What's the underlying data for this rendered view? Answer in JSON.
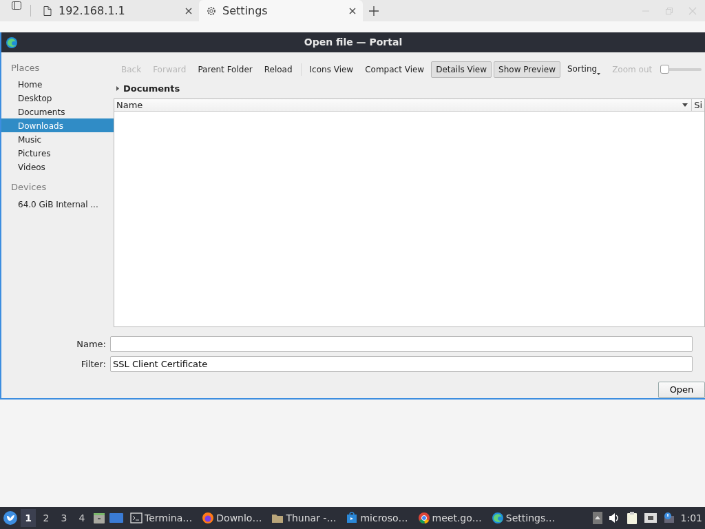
{
  "browser_tabs": [
    {
      "label": "192.168.1.1",
      "kind": "page",
      "selected": false
    },
    {
      "label": "Settings",
      "kind": "settings",
      "selected": true
    }
  ],
  "dialog": {
    "title": "Open file — Portal"
  },
  "sidebar": [
    {
      "heading": "Places",
      "items": [
        {
          "label": "Home",
          "selected": false
        },
        {
          "label": "Desktop",
          "selected": false
        },
        {
          "label": "Documents",
          "selected": false
        },
        {
          "label": "Downloads",
          "selected": true
        },
        {
          "label": "Music",
          "selected": false
        },
        {
          "label": "Pictures",
          "selected": false
        },
        {
          "label": "Videos",
          "selected": false
        }
      ]
    },
    {
      "heading": "Devices",
      "items": [
        {
          "label": "64.0 GiB Internal ...",
          "selected": false
        }
      ]
    }
  ],
  "toolbar": [
    {
      "label": "Back",
      "kind": "button",
      "disabled": true,
      "pressed": false
    },
    {
      "label": "Forward",
      "kind": "button",
      "disabled": true,
      "pressed": false
    },
    {
      "label": "Parent Folder",
      "kind": "button",
      "disabled": false,
      "pressed": false
    },
    {
      "label": "Reload",
      "kind": "button",
      "disabled": false,
      "pressed": false
    },
    {
      "kind": "separator"
    },
    {
      "label": "Icons View",
      "kind": "button",
      "disabled": false,
      "pressed": false
    },
    {
      "label": "Compact View",
      "kind": "button",
      "disabled": false,
      "pressed": false
    },
    {
      "label": "Details View",
      "kind": "button",
      "disabled": false,
      "pressed": true
    },
    {
      "label": "Show Preview",
      "kind": "button",
      "disabled": false,
      "pressed": true
    },
    {
      "label": "Sorting",
      "kind": "menu",
      "disabled": false,
      "pressed": false
    },
    {
      "label": "Zoom out",
      "kind": "button",
      "disabled": true,
      "pressed": false
    },
    {
      "kind": "slider",
      "level": 0
    }
  ],
  "location": "Documents",
  "columns": [
    "Name",
    "Si"
  ],
  "name_field": {
    "label": "Name:"
  },
  "filter_field": {
    "label": "Filter:",
    "value": "SSL Client Certificate"
  },
  "open_button": "Open",
  "taskbar": {
    "workspaces": [
      {
        "label": "1",
        "selected": true
      },
      {
        "label": "2",
        "selected": false
      },
      {
        "label": "3",
        "selected": false
      },
      {
        "label": "4",
        "selected": false
      }
    ],
    "tasks": [
      {
        "label": "Termina…",
        "kind": "terminal"
      },
      {
        "label": "Downlo…",
        "kind": "firefox"
      },
      {
        "label": "Thunar -…",
        "kind": "folder"
      },
      {
        "label": "microso…",
        "kind": "store"
      },
      {
        "label": "meet.go…",
        "kind": "chrome"
      },
      {
        "label": "Settings…",
        "kind": "edge"
      }
    ],
    "clock": "1:01"
  }
}
